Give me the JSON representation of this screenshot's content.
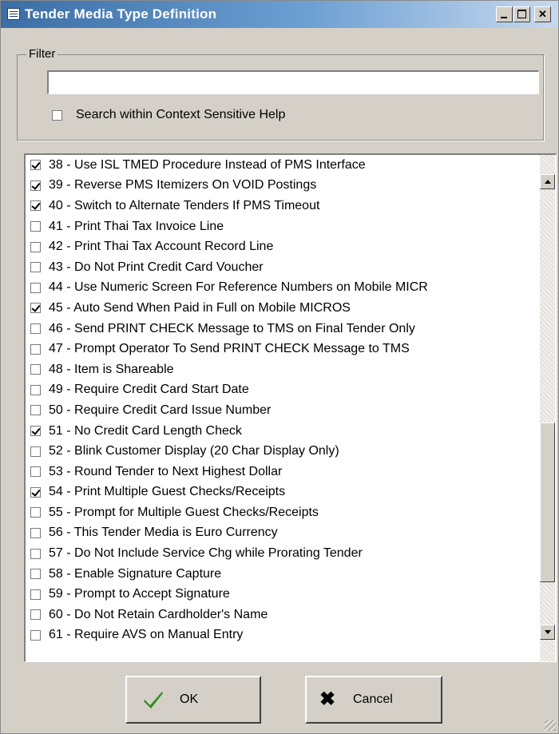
{
  "window": {
    "title": "Tender Media Type Definition",
    "icons": [
      "window-app-icon",
      "minimize-icon",
      "maximize-icon",
      "close-icon"
    ]
  },
  "filter": {
    "legend": "Filter",
    "input_value": "",
    "search_help_label": "Search within Context Sensitive Help",
    "search_help_checked": false
  },
  "options": [
    {
      "label": "38 - Use ISL TMED Procedure Instead of PMS Interface",
      "checked": true
    },
    {
      "label": "39 - Reverse PMS Itemizers On VOID Postings",
      "checked": true
    },
    {
      "label": "40 - Switch to Alternate Tenders If PMS Timeout",
      "checked": true
    },
    {
      "label": "41 - Print Thai Tax Invoice Line",
      "checked": false
    },
    {
      "label": "42 - Print Thai Tax Account Record Line",
      "checked": false
    },
    {
      "label": "43 - Do Not Print Credit Card Voucher",
      "checked": false
    },
    {
      "label": "44 - Use Numeric Screen For Reference Numbers on Mobile MICR",
      "checked": false
    },
    {
      "label": "45 - Auto Send When Paid in Full on Mobile MICROS",
      "checked": true
    },
    {
      "label": "46 - Send PRINT CHECK Message to TMS on Final Tender Only",
      "checked": false
    },
    {
      "label": "47 - Prompt Operator To Send PRINT CHECK Message to TMS",
      "checked": false
    },
    {
      "label": "48 - Item is Shareable",
      "checked": false
    },
    {
      "label": "49 - Require Credit Card Start Date",
      "checked": false
    },
    {
      "label": "50 - Require Credit Card Issue Number",
      "checked": false
    },
    {
      "label": "51 - No Credit Card Length Check",
      "checked": true
    },
    {
      "label": "52 - Blink Customer Display (20 Char Display Only)",
      "checked": false
    },
    {
      "label": "53 - Round Tender to Next Highest Dollar",
      "checked": false
    },
    {
      "label": "54 - Print Multiple Guest Checks/Receipts",
      "checked": true
    },
    {
      "label": "55 - Prompt for Multiple Guest Checks/Receipts",
      "checked": false
    },
    {
      "label": "56 - This Tender Media is Euro Currency",
      "checked": false
    },
    {
      "label": "57 - Do Not Include Service Chg while Prorating Tender",
      "checked": false
    },
    {
      "label": "58 - Enable Signature Capture",
      "checked": false
    },
    {
      "label": "59 - Prompt to Accept Signature",
      "checked": false
    },
    {
      "label": "60 - Do Not Retain Cardholder's Name",
      "checked": false
    },
    {
      "label": "61 - Require AVS on Manual Entry",
      "checked": false
    }
  ],
  "buttons": {
    "ok_label": "OK",
    "ok_icon": "checkmark-icon",
    "ok_icon_color": "#2f8a1f",
    "cancel_label": "Cancel",
    "cancel_icon": "x-icon"
  }
}
